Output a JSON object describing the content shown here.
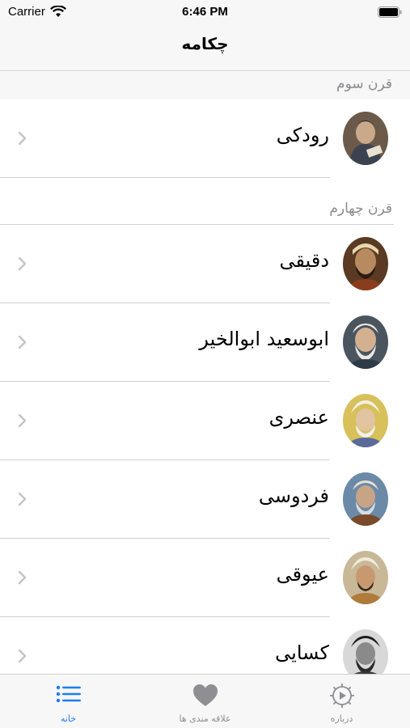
{
  "status_bar": {
    "carrier": "Carrier",
    "time": "6:46 PM"
  },
  "nav": {
    "title": "چکامه"
  },
  "sections": [
    {
      "header": "قرن سوم",
      "items": [
        {
          "label": "رودکی",
          "avatar": "poet-portrait"
        }
      ]
    },
    {
      "header": "قرن چهارم",
      "items": [
        {
          "label": "دقیقی",
          "avatar": "poet-portrait"
        },
        {
          "label": "ابوسعید ابوالخیر",
          "avatar": "poet-portrait"
        },
        {
          "label": "عنصری",
          "avatar": "poet-portrait"
        },
        {
          "label": "فردوسی",
          "avatar": "poet-portrait"
        },
        {
          "label": "عیوقی",
          "avatar": "poet-portrait"
        },
        {
          "label": "کسایی",
          "avatar": "poet-portrait"
        }
      ]
    }
  ],
  "tab_bar": {
    "tabs": [
      {
        "label": "خانه",
        "icon": "list-icon",
        "active": true
      },
      {
        "label": "علاقه مندی ها",
        "icon": "heart-icon",
        "active": false
      },
      {
        "label": "درباره",
        "icon": "gear-play-icon",
        "active": false
      }
    ]
  },
  "colors": {
    "accent": "#1a7cf5",
    "inactive": "#8e8e93",
    "separator": "#d0d0d4"
  }
}
